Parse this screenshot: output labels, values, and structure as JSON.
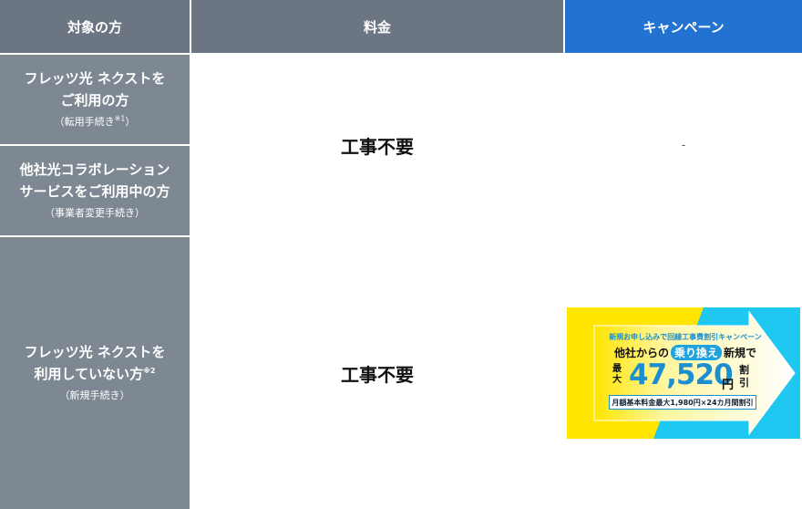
{
  "header": {
    "target": "対象の方",
    "fee": "料金",
    "campaign": "キャンペーン"
  },
  "rows": [
    {
      "main_line1": "フレッツ光 ネクストを",
      "main_line2": "ご利用の方",
      "note": "（転用手続き",
      "note_sup": "※1",
      "note_end": "）"
    },
    {
      "main_line1": "他社光コラボレーション",
      "main_line2": "サービスをご利用中の方",
      "note": "（事業者変更手続き）"
    },
    {
      "main_line1": "フレッツ光 ネクストを",
      "main_line2": "利用していない方",
      "main_sup": "※2",
      "note": "（新規手続き）"
    }
  ],
  "fees": [
    "工事不要",
    "工事不要"
  ],
  "campaign_dash": "-",
  "banner": {
    "top_text": "新規お申し込みで回線工事費割引キャンペーン",
    "mid_prefix": "他社からの",
    "mid_pill": "乗り換え",
    "mid_suffix": "新規で",
    "max_label": "最大",
    "amount": "47,520",
    "yen": "円",
    "discount": "割引",
    "box_text": "月額基本料金最大1,980円×24カ月間割引",
    "colors": {
      "yellow": "#ffe500",
      "cyan": "#1ec8f0",
      "blue": "#1b8fd0"
    }
  }
}
